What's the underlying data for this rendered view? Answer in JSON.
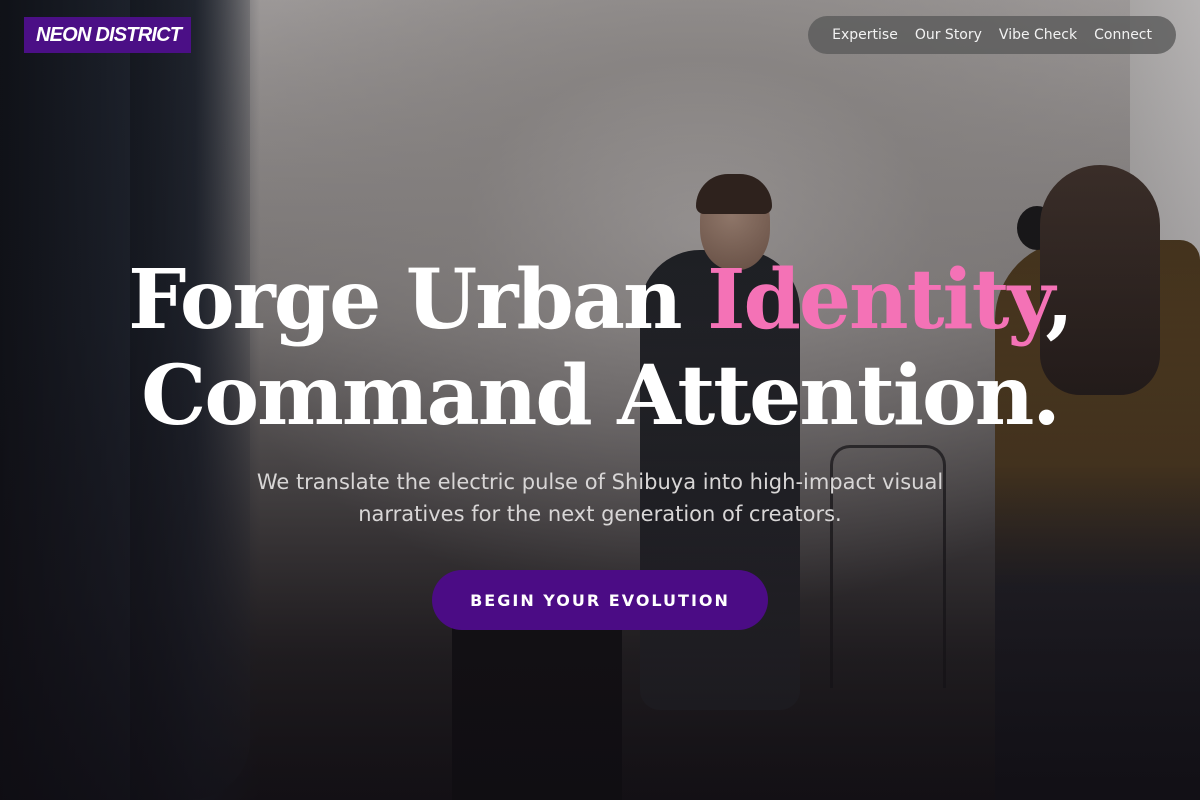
{
  "brand": {
    "logo_text": "NEON DISTRICT",
    "logo_color": "#4b0f86"
  },
  "nav": {
    "items": [
      {
        "label": "Expertise"
      },
      {
        "label": "Our Story"
      },
      {
        "label": "Vibe Check"
      },
      {
        "label": "Connect"
      }
    ]
  },
  "hero": {
    "headline_part1": "Forge Urban ",
    "headline_accent": "Identity",
    "headline_part2": ",",
    "headline_line2": "Command Attention.",
    "accent_color": "#f472b6",
    "subtitle": "We translate the electric pulse of Shibuya into high-impact visual narratives for the next generation of creators.",
    "cta_label": "BEGIN YOUR EVOLUTION",
    "cta_color": "#4b0c85"
  }
}
